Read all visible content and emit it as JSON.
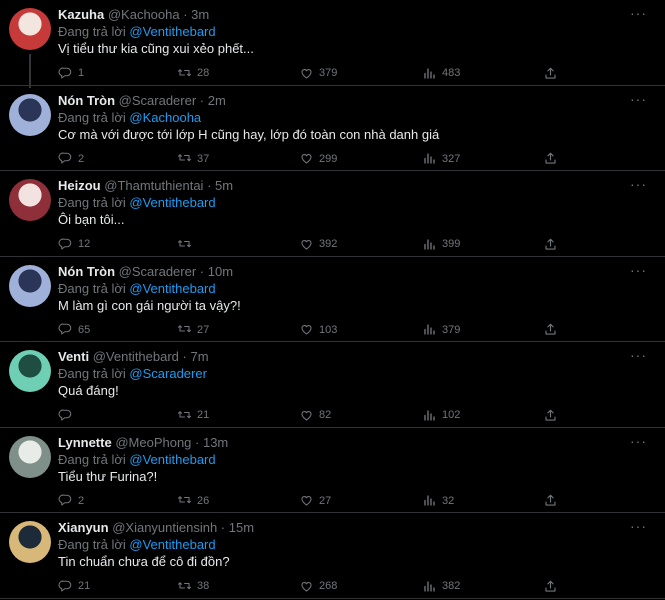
{
  "labels": {
    "replying_to": "Đang trả lời"
  },
  "colors": {
    "background": "#000000",
    "text": "#e7e9ea",
    "muted": "#71767b",
    "link": "#1d9bf0",
    "divider": "#2f3336"
  },
  "tweets": [
    {
      "name": "Kazuha",
      "handle": "@Kachooha",
      "time": "3m",
      "reply_to": "@Ventithebard",
      "text": "Vị tiểu thư kia cũng xui xẻo phết...",
      "replies": "1",
      "retweets": "28",
      "likes": "379",
      "views": "483",
      "avatar_colors": [
        "#f3e6df",
        "#c73a3a"
      ]
    },
    {
      "name": "Nón Tròn",
      "handle": "@Scaraderer",
      "time": "2m",
      "reply_to": "@Kachooha",
      "text": "Cơ mà với được tới lớp H cũng hay, lớp đó toàn con nhà danh giá",
      "replies": "2",
      "retweets": "37",
      "likes": "299",
      "views": "327",
      "avatar_colors": [
        "#2a3558",
        "#9fb1d8"
      ]
    },
    {
      "name": "Heizou",
      "handle": "@Thamtuthientai",
      "time": "5m",
      "reply_to": "@Ventithebard",
      "text": "Ôi bạn tôi...",
      "replies": "12",
      "retweets": "",
      "likes": "392",
      "views": "399",
      "avatar_colors": [
        "#f2e3e1",
        "#8e2f3a"
      ]
    },
    {
      "name": "Nón Tròn",
      "handle": "@Scaraderer",
      "time": "10m",
      "reply_to": "@Ventithebard",
      "text": "M làm gì con gái người ta vậy?!",
      "replies": "65",
      "retweets": "27",
      "likes": "103",
      "views": "379",
      "avatar_colors": [
        "#2a3558",
        "#9fb1d8"
      ]
    },
    {
      "name": "Venti",
      "handle": "@Ventithebard",
      "time": "7m",
      "reply_to": "@Scaraderer",
      "text": "Quá đáng!",
      "replies": "",
      "retweets": "21",
      "likes": "82",
      "views": "102",
      "avatar_colors": [
        "#1f4d42",
        "#6fcfb4"
      ]
    },
    {
      "name": "Lynnette",
      "handle": "@MeoPhong",
      "time": "13m",
      "reply_to": "@Ventithebard",
      "text": "Tiểu thư Furina?!",
      "replies": "2",
      "retweets": "26",
      "likes": "27",
      "views": "32",
      "avatar_colors": [
        "#e8ece8",
        "#7f8f8a"
      ]
    },
    {
      "name": "Xianyun",
      "handle": "@Xianyuntiensinh",
      "time": "15m",
      "reply_to": "@Ventithebard",
      "text": "Tin chuẩn chưa để cô đi đồn?",
      "replies": "21",
      "retweets": "38",
      "likes": "268",
      "views": "382",
      "avatar_colors": [
        "#1c2a3a",
        "#d8b878"
      ]
    }
  ]
}
